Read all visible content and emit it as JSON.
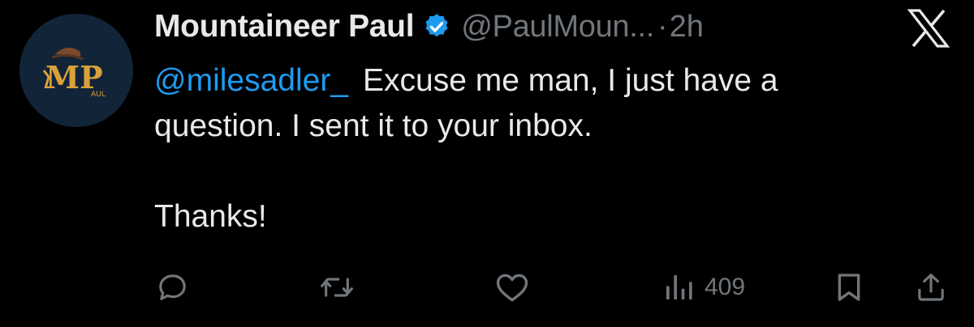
{
  "tweet": {
    "avatar": {
      "initials": "MP",
      "sub_label": "AUL",
      "background": "#122437",
      "accent": "#d8a13a"
    },
    "author": {
      "display_name": "Mountaineer Paul",
      "handle": "@PaulMoun...",
      "verified_icon": "verified-badge-icon",
      "verified_color": "#1d9bf0"
    },
    "separator": "·",
    "timestamp": "2h",
    "mention": "@milesadler_",
    "text_line1": "Excuse me man, I just have a",
    "text_line2": "question. I sent it to your inbox.",
    "text_line3": "Thanks!",
    "mention_color": "#1d9bf0"
  },
  "actions": {
    "reply_icon": "reply-icon",
    "retweet_icon": "retweet-icon",
    "like_icon": "heart-icon",
    "views_icon": "views-icon",
    "views_count": "409",
    "bookmark_icon": "bookmark-icon",
    "share_icon": "share-icon"
  },
  "app": {
    "logo_icon": "x-logo-icon"
  }
}
